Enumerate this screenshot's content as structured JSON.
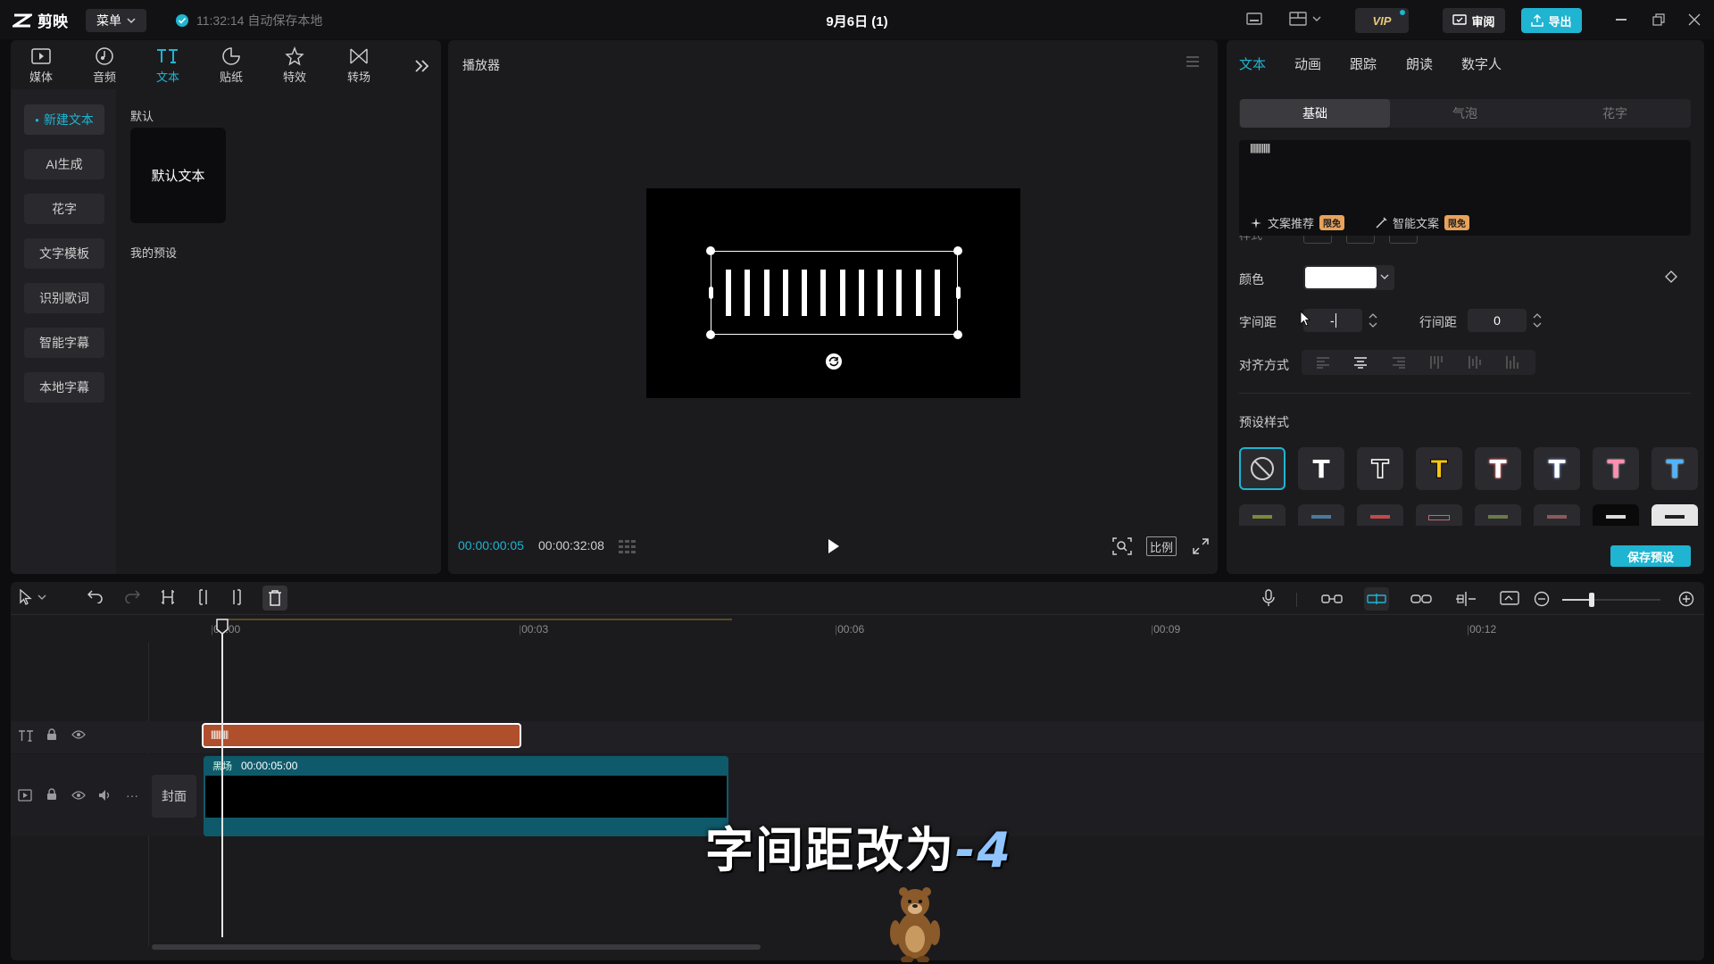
{
  "app": {
    "logo_text": "剪映",
    "menu_label": "菜单",
    "autosave_text": "11:32:14 自动保存本地",
    "project_title": "9月6日 (1)",
    "vip_label": "VIP",
    "review_label": "审阅",
    "export_label": "导出"
  },
  "left_tabs": [
    {
      "label": "媒体",
      "icon": "media-icon"
    },
    {
      "label": "音频",
      "icon": "audio-icon"
    },
    {
      "label": "文本",
      "icon": "text-icon"
    },
    {
      "label": "贴纸",
      "icon": "sticker-icon"
    },
    {
      "label": "特效",
      "icon": "effects-icon"
    },
    {
      "label": "转场",
      "icon": "transition-icon"
    }
  ],
  "text_sidebar": [
    "新建文本",
    "AI生成",
    "花字",
    "文字模板",
    "识别歌词",
    "智能字幕",
    "本地字幕"
  ],
  "text_library": {
    "default_header": "默认",
    "default_card": "默认文本",
    "my_presets": "我的预设"
  },
  "player": {
    "title": "播放器",
    "current_time": "00:00:00:05",
    "total_time": "00:00:32:08",
    "ratio_label": "比例"
  },
  "inspector": {
    "tabs": [
      "文本",
      "动画",
      "跟踪",
      "朗读",
      "数字人"
    ],
    "subtabs": [
      "基础",
      "气泡",
      "花字"
    ],
    "text_content": "||||||||||||",
    "copy_recommend": "文案推荐",
    "smart_copy": "智能文案",
    "limited_free": "限免",
    "partial_label": "样式",
    "color_label": "颜色",
    "color_value": "#ffffff",
    "letter_spacing_label": "字间距",
    "letter_spacing_value": "-",
    "line_spacing_label": "行间距",
    "line_spacing_value": "0",
    "align_label": "对齐方式",
    "preset_style_label": "预设样式",
    "save_preset": "保存预设",
    "preset_colors": [
      "#ffffff",
      "#ffffff",
      "#f5c518",
      "#ff6b6b",
      "#8fb8ff",
      "#ff8fb0",
      "#4fb3ff"
    ]
  },
  "timeline": {
    "ruler": [
      "00:00",
      "00:03",
      "00:06",
      "00:09",
      "00:12"
    ],
    "text_clip_label": "||||||||||||",
    "video_clip_name": "黑场",
    "video_clip_duration": "00:00:05:00",
    "cover_label": "封面"
  },
  "overlay": {
    "caption_main": "字间距改为",
    "caption_value": "-4"
  },
  "colors": {
    "accent": "#1fb4d1",
    "text_clip": "#b04f2c",
    "video_clip_header": "#0f5a6a"
  }
}
